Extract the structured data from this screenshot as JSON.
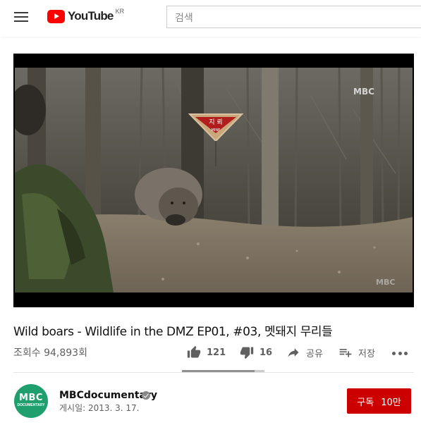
{
  "header": {
    "logo_text": "YouTube",
    "region": "KR",
    "search_placeholder": "검색"
  },
  "video": {
    "watermark_top": "MBC",
    "watermark_bottom": "MBC",
    "sign_text_ko": "지 뢰",
    "sign_text_en": "MINE"
  },
  "meta": {
    "title": "Wild boars - Wildlife in the DMZ EP01, #03, 멧돼지 무리들",
    "views": "조회수 94,893회",
    "like_count": "121",
    "dislike_count": "16",
    "share_label": "공유",
    "save_label": "저장",
    "like_ratio": 0.88
  },
  "channel": {
    "name": "MBCdocumentary",
    "date": "게시일: 2013. 3. 17.",
    "avatar_text": "MBC",
    "avatar_sub": "DOCUMENTARY",
    "subscribe_label": "구독",
    "subscriber_count": "10만"
  },
  "colors": {
    "brand_red": "#ff0000",
    "subscribe_red": "#cc0000",
    "avatar_green": "#1f9f6e"
  },
  "icons": [
    "menu-icon",
    "youtube-logo-icon",
    "thumbs-up-icon",
    "thumbs-down-icon",
    "share-icon",
    "playlist-add-icon",
    "more-icon",
    "verified-icon"
  ]
}
